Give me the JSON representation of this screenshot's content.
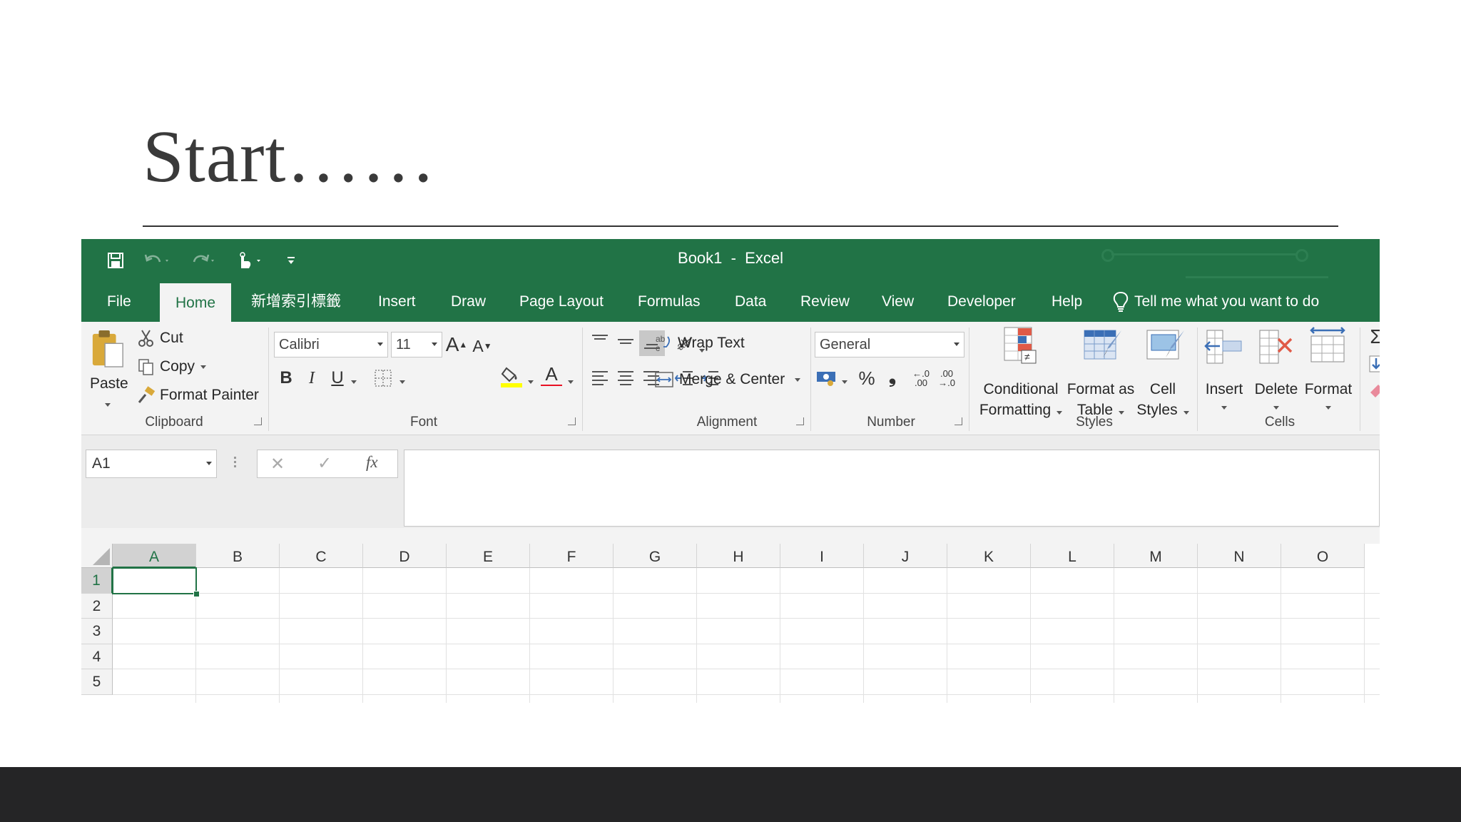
{
  "slide": {
    "title": "Start……"
  },
  "window": {
    "title": "Book1  -  Excel"
  },
  "tabs": [
    "File",
    "Home",
    "新增索引標籤",
    "Insert",
    "Draw",
    "Page Layout",
    "Formulas",
    "Data",
    "Review",
    "View",
    "Developer",
    "Help"
  ],
  "tell_me": "Tell me what you want to do",
  "clipboard": {
    "label": "Clipboard",
    "paste": "Paste",
    "cut": "Cut",
    "copy": "Copy",
    "format_painter": "Format Painter"
  },
  "font": {
    "label": "Font",
    "name": "Calibri",
    "size": "11",
    "bold": "B",
    "italic": "I",
    "underline": "U",
    "grow": "A",
    "shrink": "A",
    "font_color": "A"
  },
  "alignment": {
    "label": "Alignment",
    "wrap_text": "Wrap Text",
    "merge_center": "Merge & Center"
  },
  "number": {
    "label": "Number",
    "format": "General",
    "percent": "%",
    "comma": "❟",
    "inc_decimal": "←.0\n.00",
    "dec_decimal": ".00\n→.0"
  },
  "styles": {
    "label": "Styles",
    "conditional": "Conditional",
    "conditional2": "Formatting",
    "format_as": "Format as",
    "format_as2": "Table",
    "cell": "Cell",
    "cell2": "Styles"
  },
  "cells": {
    "label": "Cells",
    "insert": "Insert",
    "delete": "Delete",
    "format": "Format"
  },
  "editing": {
    "sum": "Σ"
  },
  "formula_bar": {
    "name_box": "A1",
    "fx": "fx",
    "cancel": "✕",
    "enter": "✓"
  },
  "sheet": {
    "columns": [
      "A",
      "B",
      "C",
      "D",
      "E",
      "F",
      "G",
      "H",
      "I",
      "J",
      "K",
      "L",
      "M",
      "N",
      "O"
    ],
    "rows": [
      "1",
      "2",
      "3",
      "4",
      "5"
    ],
    "active_cell": "A1"
  },
  "colors": {
    "excel_green": "#217346",
    "font_color_bar": "#e81123",
    "highlight_bar": "#ffff00"
  }
}
